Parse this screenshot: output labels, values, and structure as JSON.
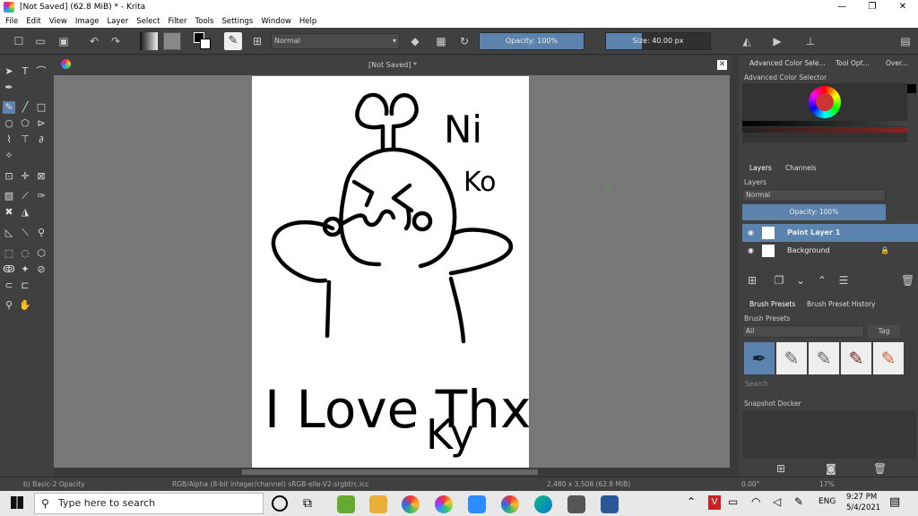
{
  "window": {
    "title": "[Not Saved]  (62.8 MiB)  * - Krita",
    "controls": [
      "—",
      "❐",
      "✕"
    ]
  },
  "menu": [
    "File",
    "Edit",
    "View",
    "Image",
    "Layer",
    "Select",
    "Filter",
    "Tools",
    "Settings",
    "Window",
    "Help"
  ],
  "toolbar": {
    "blend_mode": "Normal",
    "opacity_label": "Opacity: 100%",
    "opacity_value": 1.0,
    "size_label": "Size: 40.00 px"
  },
  "document": {
    "tab_title": "[Not Saved]  *",
    "drawing_text_1": "Ni",
    "drawing_text_2": "Ko",
    "drawing_text_3": "I Love Thx",
    "drawing_text_4": "Ky"
  },
  "dockers": {
    "tabs": [
      "Advanced Color Sele...",
      "Tool Opt...",
      "Over..."
    ],
    "color_selector_title": "Advanced Color Selector",
    "layer_tabs": [
      "Layers",
      "Channels"
    ],
    "layers_title": "Layers",
    "layer_blend": "Normal",
    "layer_opacity": "Opacity:  100%",
    "layers": [
      {
        "name": "Paint Layer 1",
        "selected": true
      },
      {
        "name": "Background",
        "selected": false
      }
    ],
    "brush_tabs": [
      "Brush Presets",
      "Brush Preset History"
    ],
    "brush_title": "Brush Presets",
    "brush_filter": "All",
    "tag_label": "Tag",
    "search_placeholder": "Search",
    "snapshot_title": "Snapshot Docker"
  },
  "status": {
    "brush": "b) Basic-2 Opacity",
    "colorspace": "RGB/Alpha (8-bit integer/channel)  sRGB-elle-V2-srgbtrc.icc",
    "dimensions": "2,480 x 3,508 (62.8 MiB)",
    "rotation": "0.00°",
    "zoom": "17%"
  },
  "taskbar": {
    "search_placeholder": "Type here to search",
    "lang": "ENG",
    "time": "9:27 PM",
    "date": "5/4/2021"
  },
  "colors": {
    "accent": "#5b83ad",
    "panel": "#404040",
    "canvas_bg": "#777777"
  }
}
